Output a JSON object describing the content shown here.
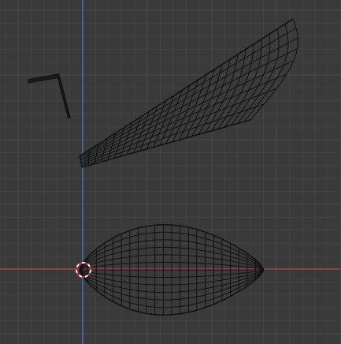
{
  "viewport": {
    "view": "orthographic",
    "grid": true,
    "background_color": "#3a3a3a",
    "grid_minor_color": "#444444",
    "grid_major_color": "#4c4c4c",
    "x_axis_color": "#b34456",
    "y_axis_color": "#4a72b0",
    "wire_color": "#111111"
  },
  "objects": [
    {
      "name": "wing-mesh",
      "type": "mesh",
      "selected": false
    },
    {
      "name": "allen-key-mesh",
      "type": "mesh",
      "selected": false
    },
    {
      "name": "body-mesh",
      "type": "mesh",
      "selected": false
    }
  ],
  "origin_marker": {
    "color_a": "#ffffff",
    "color_b": "#d8323c"
  }
}
